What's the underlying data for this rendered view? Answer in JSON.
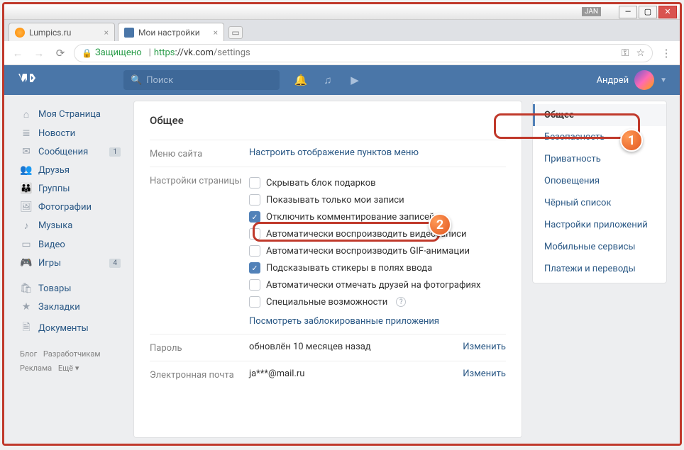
{
  "window": {
    "user_badge": "JAN"
  },
  "tabs": [
    {
      "title": "Lumpics.ru",
      "favicon": "orange",
      "active": false
    },
    {
      "title": "Мои настройки",
      "favicon": "vk",
      "active": true
    }
  ],
  "addressbar": {
    "secure_label": "Защищено",
    "proto": "https",
    "host": "://vk.com",
    "path": "/settings"
  },
  "vk_header": {
    "search_placeholder": "Поиск",
    "username": "Андрей"
  },
  "sidebar": {
    "items": [
      {
        "icon": "⌂",
        "label": "Моя Страница"
      },
      {
        "icon": "≣",
        "label": "Новости"
      },
      {
        "icon": "✉",
        "label": "Сообщения",
        "badge": "1"
      },
      {
        "icon": "👥",
        "label": "Друзья"
      },
      {
        "icon": "👪",
        "label": "Группы"
      },
      {
        "icon": "🖼",
        "label": "Фотографии"
      },
      {
        "icon": "♪",
        "label": "Музыка"
      },
      {
        "icon": "▭",
        "label": "Видео"
      },
      {
        "icon": "🎮",
        "label": "Игры",
        "badge": "4"
      }
    ],
    "items2": [
      {
        "icon": "🛍",
        "label": "Товары"
      },
      {
        "icon": "★",
        "label": "Закладки"
      },
      {
        "icon": "🗎",
        "label": "Документы"
      }
    ],
    "footer": {
      "blog": "Блог",
      "dev": "Разработчикам",
      "ads": "Реклама",
      "more": "Ещё ▾"
    }
  },
  "content": {
    "title": "Общее",
    "menu_section_label": "Меню сайта",
    "menu_section_link": "Настроить отображение пунктов меню",
    "page_settings_label": "Настройки страницы",
    "checkboxes": [
      {
        "label": "Скрывать блок подарков",
        "checked": false
      },
      {
        "label": "Показывать только мои записи",
        "checked": false
      },
      {
        "label": "Отключить комментирование записей",
        "checked": true,
        "highlighted": true
      },
      {
        "label": "Автоматически воспроизводить видеозаписи",
        "checked": false
      },
      {
        "label": "Автоматически воспроизводить GIF-анимации",
        "checked": false
      },
      {
        "label": "Подсказывать стикеры в полях ввода",
        "checked": true
      },
      {
        "label": "Автоматически отмечать друзей на фотографиях",
        "checked": false
      },
      {
        "label": "Специальные возможности",
        "checked": false,
        "help": true
      }
    ],
    "blocked_apps_link": "Посмотреть заблокированные приложения",
    "password_label": "Пароль",
    "password_value": "обновлён 10 месяцев назад",
    "email_label": "Электронная почта",
    "email_value": "ja***@mail.ru",
    "change_label": "Изменить"
  },
  "right_nav": {
    "items": [
      {
        "label": "Общее",
        "active": true
      },
      {
        "label": "Безопасность"
      },
      {
        "label": "Приватность"
      },
      {
        "label": "Оповещения"
      },
      {
        "label": "Чёрный список"
      },
      {
        "label": "Настройки приложений"
      },
      {
        "label": "Мобильные сервисы"
      },
      {
        "label": "Платежи и переводы"
      }
    ]
  },
  "callouts": {
    "one": "1",
    "two": "2"
  }
}
